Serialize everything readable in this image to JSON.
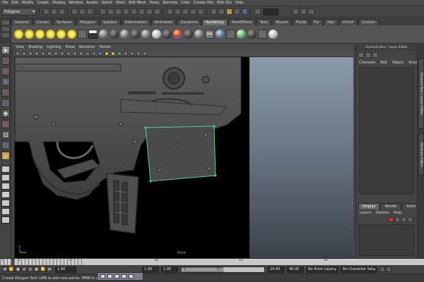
{
  "menubar": {
    "items": [
      "File",
      "Edit",
      "Modify",
      "Create",
      "Display",
      "Window",
      "Assets",
      "Select",
      "Mesh",
      "Edit Mesh",
      "Proxy",
      "Normals",
      "Color",
      "Create UVs",
      "Edit UVs",
      "Help"
    ]
  },
  "statusline": {
    "mode": "Polygons"
  },
  "shelf": {
    "tabs": [
      "General",
      "Curves",
      "Surfaces",
      "Polygons",
      "Subdivs",
      "Deformation",
      "Animation",
      "Dynamics",
      "Rendering",
      "PaintEffects",
      "Toon",
      "Muscle",
      "Fluids",
      "Fur",
      "Hair",
      "nCloth",
      "Custom"
    ],
    "active_tab": "Rendering"
  },
  "viewport": {
    "menu": [
      "View",
      "Shading",
      "Lighting",
      "Show",
      "Renderer",
      "Panels"
    ],
    "camera_label": "front"
  },
  "channel_box": {
    "title": "Channel Box / Layer Editor",
    "menu": [
      "Channels",
      "Edit",
      "Object",
      "Show"
    ]
  },
  "layer_editor": {
    "tabs": [
      "Display",
      "Render",
      "Anim"
    ],
    "active_tab": "Display",
    "menu": [
      "Layers",
      "Options",
      "Help"
    ]
  },
  "side_tabs": {
    "channel_box_tab": "Channel Box / Layer Editor",
    "attribute_editor_tab": "Attribute Editor"
  },
  "timeslider": {
    "labels": [
      "1",
      "2",
      "5",
      "10",
      "15",
      "20"
    ]
  },
  "rangebar": {
    "current_time": "1.00",
    "start_time": "1.00",
    "playback_start": "1.00",
    "range_start_label": "1",
    "range_end_label": "24",
    "playback_end": "24.00",
    "end_time": "48.00",
    "anim_layer": "No Anim Layer",
    "character_set": "No Character Set"
  },
  "helpline": {
    "text": "Create Polygon Tool: LMB to add new points. MMB to edit last pl"
  },
  "colors": {
    "ui_gray": "#444444",
    "selection_green": "#3ee08a",
    "viewport_gradient_top": "#8a9aaa"
  }
}
